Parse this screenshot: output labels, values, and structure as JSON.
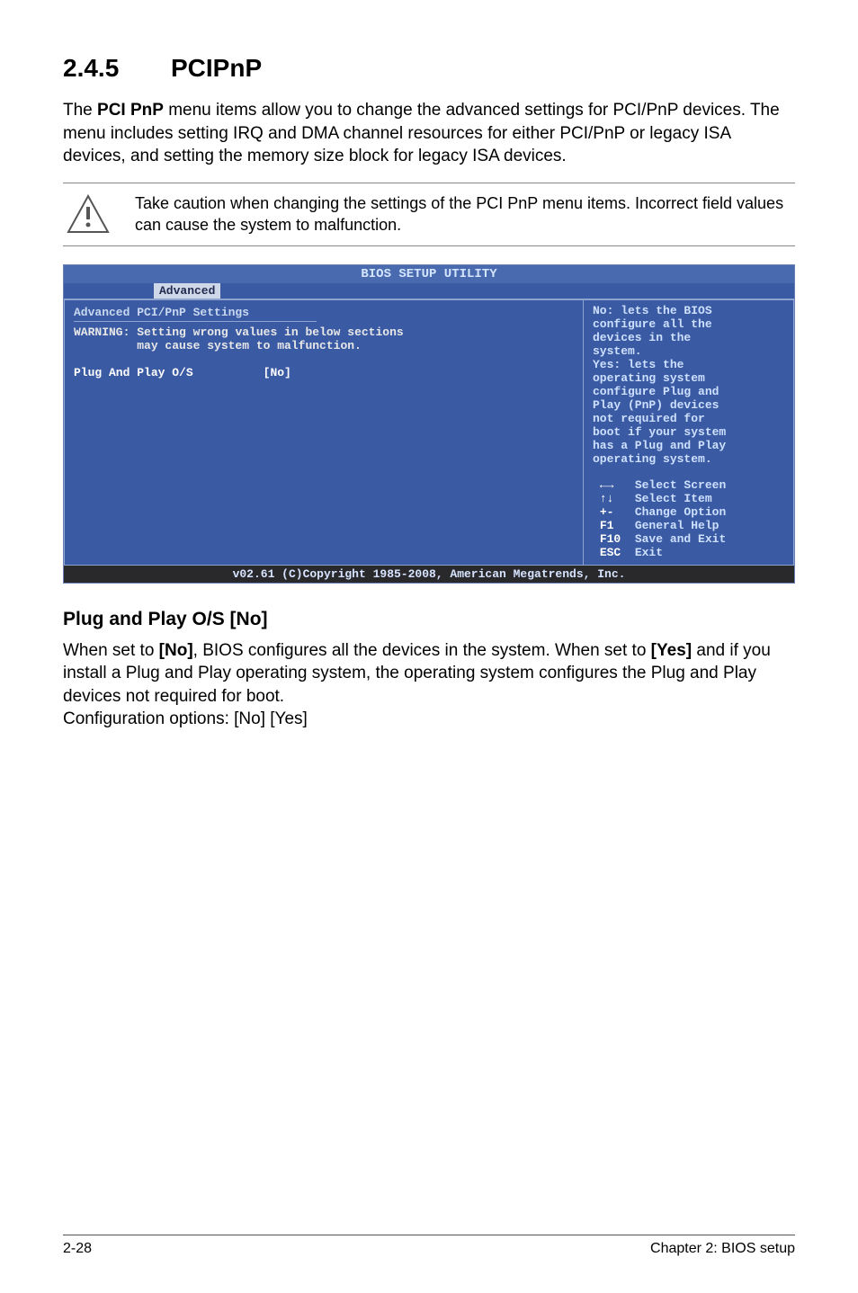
{
  "section": {
    "number": "2.4.5",
    "title": "PCIPnP"
  },
  "intro": "The PCI PnP menu items allow you to change the advanced settings for PCI/PnP devices. The menu includes setting IRQ and DMA channel resources for either PCI/PnP or legacy ISA devices, and setting the memory size block for legacy ISA devices.",
  "intro_bold": "PCI PnP",
  "caution": {
    "icon": "caution-icon",
    "text": "Take caution when changing the settings of the PCI PnP menu items. Incorrect field values can cause the system to malfunction."
  },
  "bios": {
    "title": "BIOS SETUP UTILITY",
    "tab": "Advanced",
    "left": {
      "heading": "Advanced PCI/PnP Settings",
      "warning_label": "WARNING:",
      "warning_line1": "Setting wrong values in below sections",
      "warning_line2": "may cause system to malfunction.",
      "item_label": "Plug And Play O/S",
      "item_value": "[No]"
    },
    "right": {
      "help": [
        "No: lets the BIOS",
        "configure all the",
        "devices in the",
        "system.",
        "Yes: lets the",
        "operating system",
        "configure Plug and",
        "Play (PnP) devices",
        "not required for",
        "boot if your system",
        "has a Plug and Play",
        "operating system."
      ],
      "nav": [
        {
          "key": "←→",
          "label": "Select Screen"
        },
        {
          "key": "↑↓",
          "label": "Select Item"
        },
        {
          "key": "+-",
          "label": "Change Option"
        },
        {
          "key": "F1",
          "label": "General Help"
        },
        {
          "key": "F10",
          "label": "Save and Exit"
        },
        {
          "key": "ESC",
          "label": "Exit"
        }
      ]
    },
    "footer": "v02.61 (C)Copyright 1985-2008, American Megatrends, Inc."
  },
  "subsection": {
    "heading": "Plug and Play O/S [No]",
    "body_pre": "When set to ",
    "bold1": "[No]",
    "body_mid": ", BIOS configures all the devices in the system. When set to ",
    "bold2": "[Yes]",
    "body_post": " and if you install a Plug and Play operating system, the operating system configures the Plug and Play devices not required for boot.",
    "config_line": "Configuration options: [No] [Yes]"
  },
  "footer": {
    "left": "2-28",
    "right": "Chapter 2: BIOS setup"
  }
}
